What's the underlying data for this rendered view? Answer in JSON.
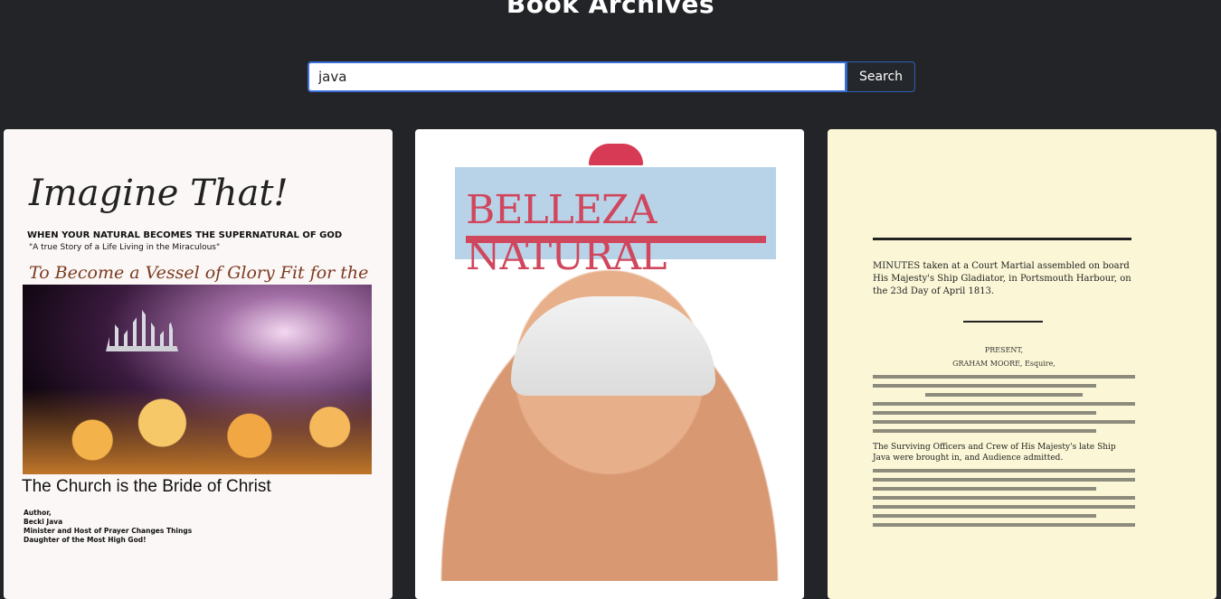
{
  "header": {
    "title": "Book Archives"
  },
  "search": {
    "value": "java",
    "placeholder": "",
    "button_label": "Search"
  },
  "books": [
    {
      "title": "Imagine That!",
      "subtitle": "WHEN YOUR NATURAL BECOMES THE SUPERNATURAL OF GOD",
      "tagline": "\"A true Story of a Life Living in the Miraculous\"",
      "script_line": "To Become a Vessel of Glory Fit for the King",
      "church_line": "The Church is the Bride of Christ",
      "author_lines": [
        "Author,",
        "Becki Java",
        "Minister and Host of Prayer Changes Things",
        "Daughter of the Most High God!"
      ]
    },
    {
      "title": "BELLEZA NATURAL"
    },
    {
      "heading": "MINUTES taken at a Court Martial assembled on board His Majesty's Ship Gladiator, in Portsmouth Harbour, on the 23d Day of April 1813.",
      "present": "PRESENT,",
      "president": "GRAHAM MOORE, Esquire,",
      "body": "The Surviving Officers and Crew of His Majesty's late Ship Java were brought in, and Audience admitted."
    }
  ]
}
